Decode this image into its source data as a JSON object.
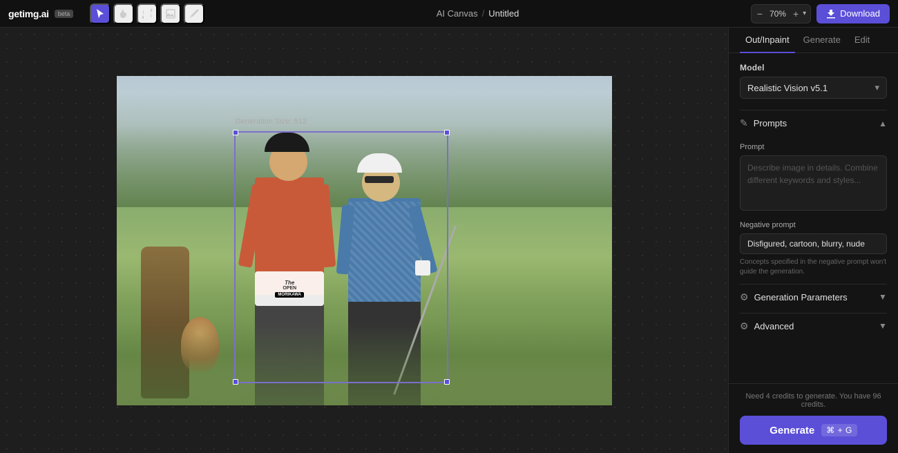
{
  "header": {
    "logo": "getimg.ai",
    "beta": "beta",
    "breadcrumb_canvas": "AI Canvas",
    "breadcrumb_separator": "/",
    "breadcrumb_file": "Untitled",
    "tools": [
      {
        "name": "select-tool",
        "icon": "▶",
        "active": true
      },
      {
        "name": "hand-tool",
        "icon": "✋",
        "active": false
      },
      {
        "name": "transform-tool",
        "icon": "⟳",
        "active": false
      },
      {
        "name": "image-tool",
        "icon": "⬜",
        "active": false
      },
      {
        "name": "brush-tool",
        "icon": "◆",
        "active": false
      }
    ],
    "zoom_minus": "−",
    "zoom_plus": "+",
    "zoom_value": "70%",
    "zoom_dropdown": "▾",
    "download_label": "Download"
  },
  "canvas": {
    "generation_size_label": "Generation Size: 512"
  },
  "sidebar": {
    "tabs": [
      {
        "label": "Out/Inpaint",
        "active": true
      },
      {
        "label": "Generate",
        "active": false
      },
      {
        "label": "Edit",
        "active": false
      }
    ],
    "model_section_label": "Model",
    "model_selected": "Realistic Vision v5.1",
    "prompts_section_label": "Prompts",
    "prompt_label": "Prompt",
    "prompt_placeholder": "Describe image in details. Combine different keywords and styles...",
    "negative_prompt_label": "Negative prompt",
    "negative_prompt_value": "Disfigured, cartoon, blurry, nude",
    "negative_prompt_hint": "Concepts specified in the negative prompt won't guide the generation.",
    "generation_params_label": "Generation Parameters",
    "advanced_label": "Advanced",
    "credits_text": "Need 4 credits to generate. You have 96 credits.",
    "generate_label": "Generate",
    "generate_shortcut": "⌘ + G"
  }
}
